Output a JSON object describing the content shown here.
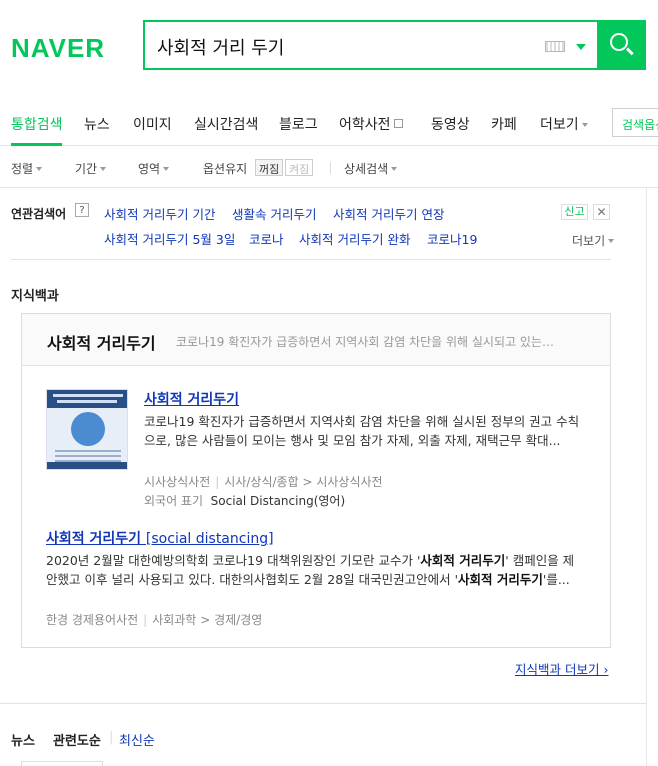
{
  "header": {
    "logo": "NAVER",
    "query": "사회적 거리 두기"
  },
  "tabs": [
    {
      "label": "통합검색",
      "active": true
    },
    {
      "label": "뉴스"
    },
    {
      "label": "이미지"
    },
    {
      "label": "실시간검색"
    },
    {
      "label": "블로그"
    },
    {
      "label": "어학사전"
    },
    {
      "label": "동영상"
    },
    {
      "label": "카페"
    },
    {
      "label": "더보기"
    }
  ],
  "search_option": "검색옵션",
  "filters": {
    "sort": "정렬",
    "period": "기간",
    "area": "영역",
    "keep_option": "옵션유지",
    "off": "꺼짐",
    "on": "켜짐",
    "detail": "상세검색"
  },
  "related": {
    "title": "연관검색어",
    "help": "?",
    "report": "신고",
    "close": "✕",
    "more": "더보기",
    "keywords": [
      "사회적 거리두기 기간",
      "생활속 거리두기",
      "사회적 거리두기 연장",
      "사회적 거리두기 5월 3일",
      "코로나",
      "사회적 거리두기 완화",
      "코로나19"
    ]
  },
  "knowledge": {
    "section": "지식백과",
    "head_title": "사회적 거리두기",
    "head_sub": "코로나19 확진자가 급증하면서 지역사회 감염 차단을 위해 실시되고 있는…",
    "entry1": {
      "title": "사회적 거리두기",
      "body": "코로나19 확진자가 급증하면서 지역사회 감염 차단을 위해 실시된 정부의 권고 수칙으로, 많은 사람들이 모이는 행사 및 모임 참가 자제, 외출 자제, 재택근무 확대...",
      "source1": "시사상식사전",
      "source2": "시사/상식/종합",
      "arrow": ">",
      "source3": "시사상식사전",
      "foreign_label": "외국어 표기",
      "foreign_value": "Social Distancing(영어)"
    },
    "entry2": {
      "title": "사회적 거리두기",
      "title_en": "[social distancing]",
      "body_1": "2020년 2월말 대한예방의학회 코로나19 대책위원장인 기모란 교수가 '",
      "body_hl1": "사회적 거리두기",
      "body_2": "' 캠페인을 제안했고 이후 널리 사용되고 있다. 대한의사협회도 2월 28일 대국민권고안에서 '",
      "body_hl2": "사회적 거리두기",
      "body_3": "'를...",
      "source1": "한경 경제용어사전",
      "source2": "사회과학",
      "arrow": ">",
      "source3": "경제/경영"
    },
    "more": "지식백과 더보기"
  },
  "news": {
    "title": "뉴스",
    "sort1": "관련도순",
    "sort2": "최신순"
  },
  "colors": {
    "brand": "#03c75a",
    "link": "#0f37b8"
  }
}
